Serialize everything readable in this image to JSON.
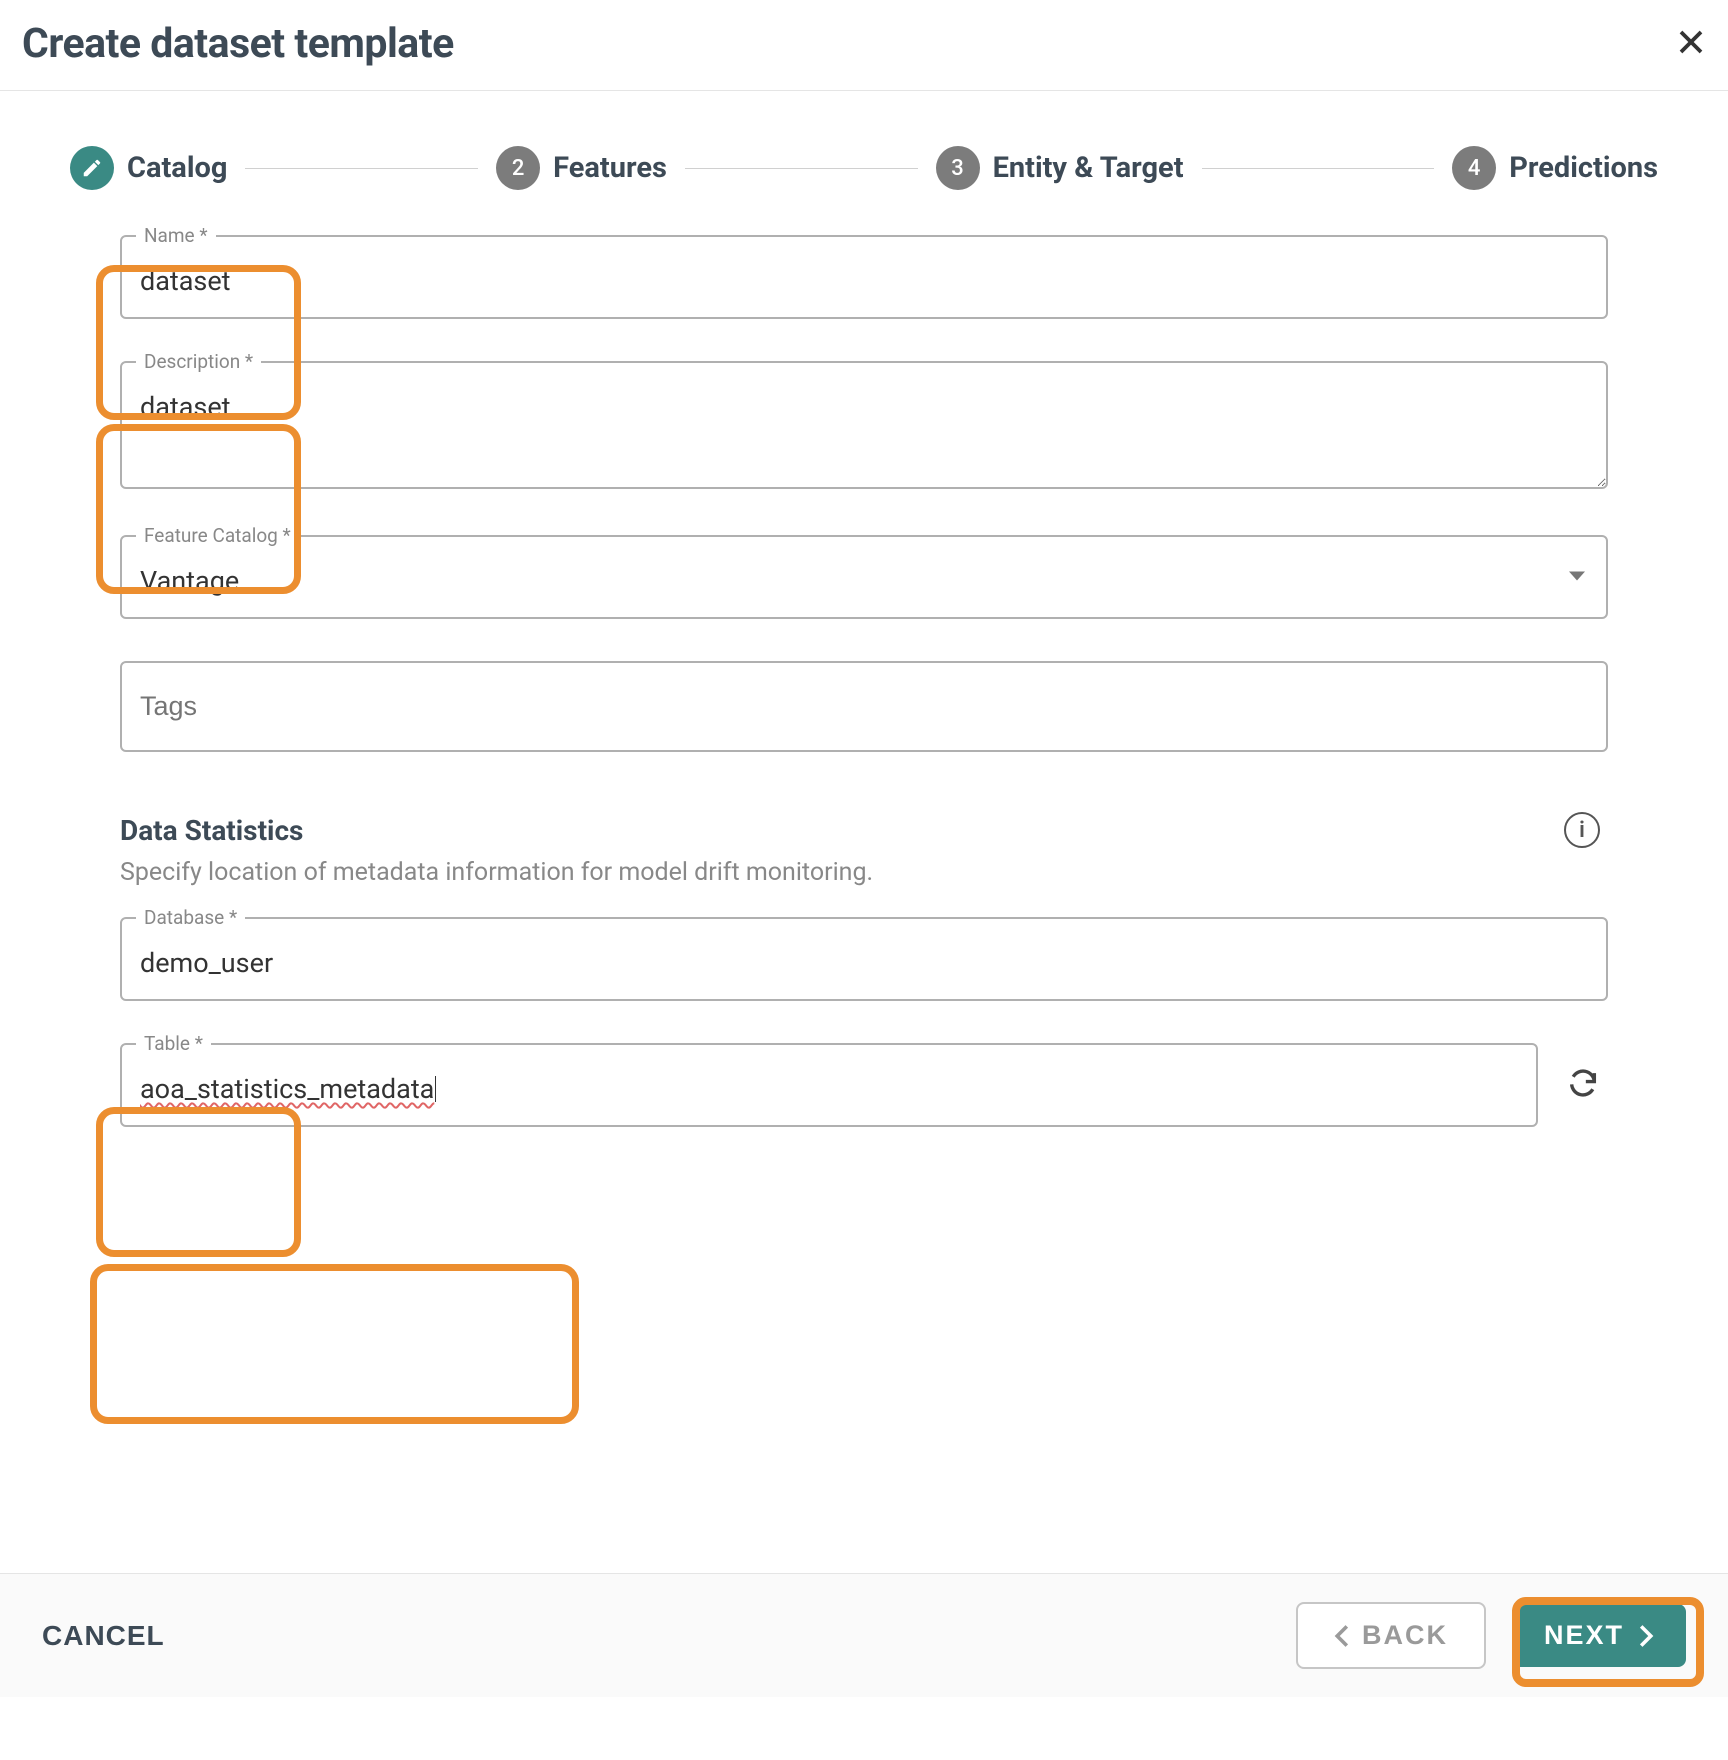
{
  "header": {
    "title": "Create dataset template"
  },
  "stepper": {
    "steps": [
      {
        "label": "Catalog",
        "active": true
      },
      {
        "label": "Features",
        "num": "2"
      },
      {
        "label": "Entity & Target",
        "num": "3"
      },
      {
        "label": "Predictions",
        "num": "4"
      }
    ]
  },
  "form": {
    "name_label": "Name *",
    "name_value": "dataset",
    "desc_label": "Description *",
    "desc_value": "dataset",
    "catalog_label": "Feature Catalog *",
    "catalog_value": "Vantage",
    "tags_placeholder": "Tags"
  },
  "stats": {
    "title": "Data Statistics",
    "desc": "Specify location of metadata information for model drift monitoring.",
    "db_label": "Database *",
    "db_value": "demo_user",
    "table_label": "Table *",
    "table_value": "aoa_statistics_metadata"
  },
  "footer": {
    "cancel": "CANCEL",
    "back": "BACK",
    "next": "NEXT"
  }
}
